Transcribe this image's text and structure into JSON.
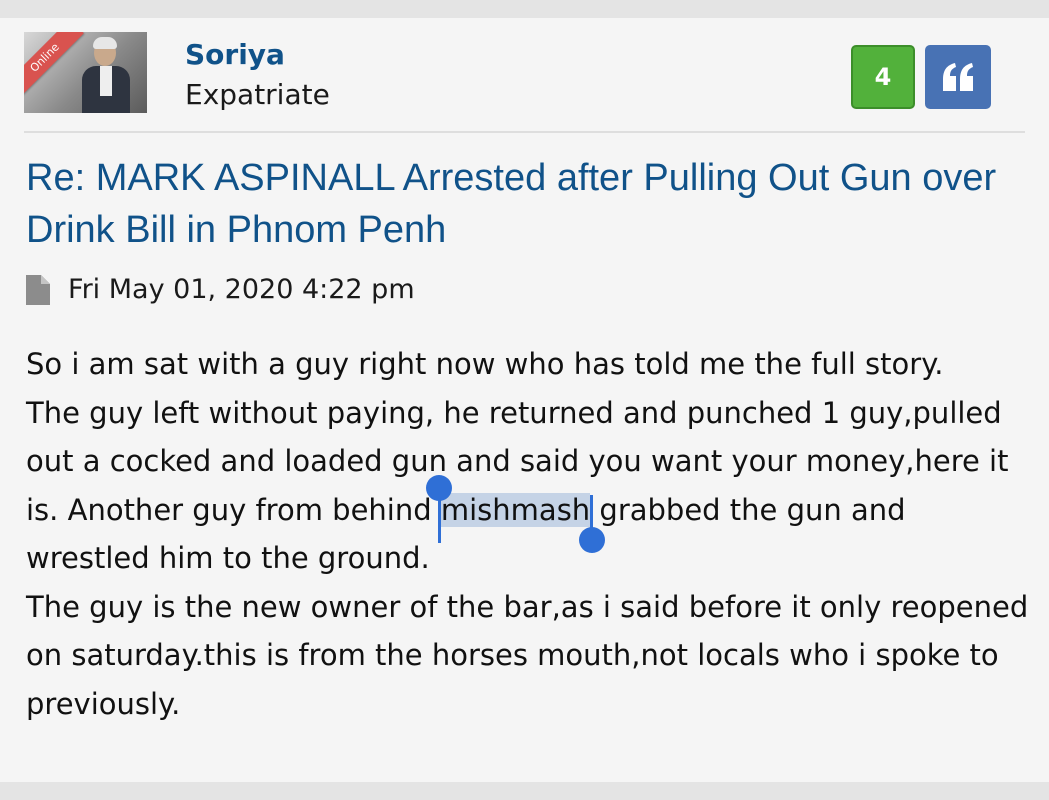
{
  "post": {
    "author": {
      "username": "Soriya",
      "rank": "Expatriate",
      "online_label": "Online",
      "avatar_icon": "user-avatar-photo"
    },
    "actions": {
      "reaction_count": "4",
      "quote_icon": "quote-icon"
    },
    "title": "Re: MARK ASPINALL Arrested after Pulling Out Gun over Drink Bill in Phnom Penh",
    "meta": {
      "icon": "document-icon",
      "timestamp": "Fri May 01, 2020 4:22 pm"
    },
    "content": {
      "p1": "So i am sat with a guy right now who has told me the full story.",
      "p2_before": "The guy left without paying, he returned and punched 1 guy,pulled out a cocked and loaded gun and said you want your money,here it is. Another guy from behind ",
      "p2_selected": "mishmash",
      "p2_after": " grabbed the gun and wrestled him to the ground.",
      "p3": "The guy is the new owner of the bar,as i said before it only reopened on saturday.this is from the horses mouth,not locals who i spoke to previously."
    }
  },
  "colors": {
    "link": "#105289",
    "reaction_green": "#52b13b",
    "quote_blue": "#4872b4",
    "online_red": "#d9534f",
    "selection_handle": "#2f6fd6",
    "selection_bg": "#c5d3e6"
  }
}
